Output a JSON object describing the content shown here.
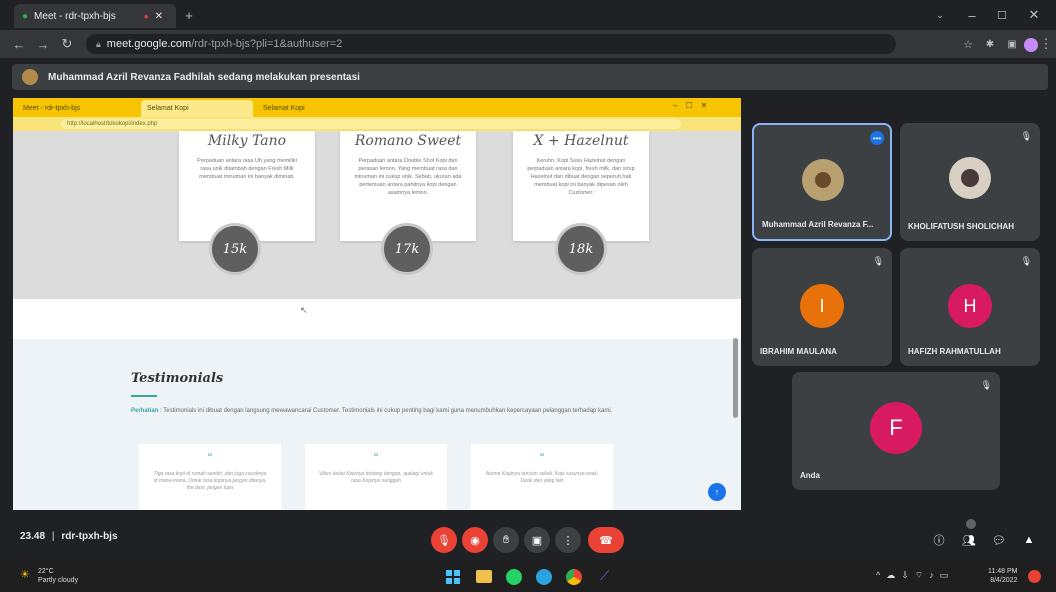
{
  "outer_browser": {
    "tabs": [
      {
        "label": "Meet - rdr-tpxh-bjs",
        "active": true
      },
      {
        "label": "",
        "active": false
      }
    ],
    "url_host": "meet.google.com",
    "url_path": "/rdr-tpxh-bjs?pli=1&authuser=2"
  },
  "presenting_banner": "Muhammad Azril Revanza Fadhilah sedang melakukan presentasi",
  "shared_screen": {
    "inner_tabs": [
      "Meet - rdr-tpxh-bjs",
      "Selamat Kopi",
      "Selamat Kopi"
    ],
    "inner_url": "http://localhost/tokokopi/index.php",
    "products": [
      {
        "name": "Milky Tano",
        "desc": "Perpaduan antara rasa Uh yang memiliki rasa unik ditambah dengan Fresh Milk membuat minuman ini banyak diminati.",
        "price": "15k"
      },
      {
        "name": "Romano Sweet",
        "desc": "Perpaduan antara Double Shot Kopi dan perasan lemon. Yang membuat rasa dan minuman ini cukup unik. Sebab, ukuran ada pertemuan antara pahitnya kopi dengan asamnya lemon.",
        "price": "17k"
      },
      {
        "name": "X + Hazelnut",
        "desc": "Keruhn, Kopi Susu Hazelnut dengan perpaduan antara kopi, fresh milk, dan sirup Hazelnut dan dibuat dengan seperuh hati membuat kopi ini banyak dipesan oleh Customer.",
        "price": "18k"
      }
    ],
    "testimonials_title": "Testimonials",
    "testimonials_lead_bold": "Perhatian",
    "testimonials_lead": " : Testimonials ini dibuat dengan langsung mewawancarai Customer. Testimonials ini cukup penting bagi kami guna menumbuhkan kepercayaan pelanggan terhadap kami.",
    "testimonial_cards": [
      "Tiga rasa kopi di rumah sendiri, dan juga cocoknya di mana-mana. Untuk rasa kopinya jangan ditanya, the best, jangan lupa",
      "Vibes kedai Kopinya tentang dengan, apalagi untuk rasa Kopinya sanggah",
      "Aroma Kopinya tercium sekali. Kopi susunya enak, Dede dan yang lain"
    ]
  },
  "participants": [
    {
      "name": "Muhammad Azril Revanza F...",
      "has_photo": true,
      "presenting": true
    },
    {
      "name": "KHOLIFATUSH SHOLICHAH",
      "has_photo": true
    },
    {
      "name": "IBRAHIM MAULANA",
      "initial": "I",
      "color": "#e8710a"
    },
    {
      "name": "HAFIZH RAHMATULLAH",
      "initial": "H",
      "color": "#d81b60"
    },
    {
      "name": "Anda",
      "initial": "F",
      "color": "#d81b60"
    }
  ],
  "meeting_info": {
    "time": "23.48",
    "code": "rdr-tpxh-bjs"
  },
  "taskbar": {
    "weather_temp": "22°C",
    "weather_desc": "Partly cloudy",
    "clock_time": "11:48 PM",
    "clock_date": "8/4/2022"
  },
  "colors": {
    "meet_red": "#ea4335",
    "tile_bg": "#3c4043",
    "inner_browser_yellow": "#f6c400"
  }
}
